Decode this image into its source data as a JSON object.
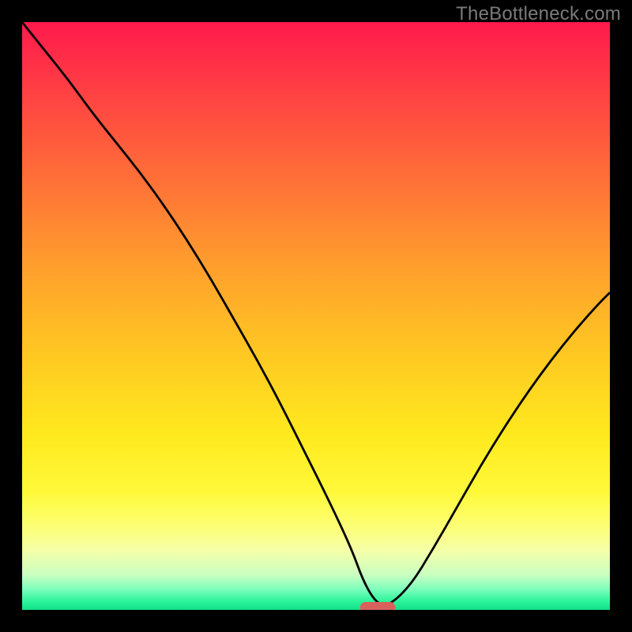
{
  "watermark": "TheBottleneck.com",
  "colors": {
    "frame": "#000000",
    "watermark": "#7a7a7a",
    "curve": "#000000",
    "marker_fill": "#d9615d",
    "gradient_stops": [
      {
        "offset": 0.0,
        "color": "#ff1a4c"
      },
      {
        "offset": 0.1,
        "color": "#ff3a45"
      },
      {
        "offset": 0.25,
        "color": "#ff6a39"
      },
      {
        "offset": 0.4,
        "color": "#ff9a2e"
      },
      {
        "offset": 0.55,
        "color": "#ffc423"
      },
      {
        "offset": 0.7,
        "color": "#ffe91e"
      },
      {
        "offset": 0.8,
        "color": "#fff93a"
      },
      {
        "offset": 0.86,
        "color": "#fcff77"
      },
      {
        "offset": 0.9,
        "color": "#f4ffa9"
      },
      {
        "offset": 0.94,
        "color": "#caffc1"
      },
      {
        "offset": 0.965,
        "color": "#7dffbc"
      },
      {
        "offset": 0.985,
        "color": "#2cf49b"
      },
      {
        "offset": 1.0,
        "color": "#10df87"
      }
    ]
  },
  "chart_data": {
    "type": "line",
    "title": "",
    "xlabel": "",
    "ylabel": "",
    "xlim": [
      0,
      100
    ],
    "ylim": [
      0,
      100
    ],
    "x": [
      0,
      4,
      8,
      12,
      16,
      20,
      24,
      28,
      32,
      36,
      40,
      44,
      48,
      52,
      56,
      58,
      60,
      62,
      66,
      70,
      74,
      78,
      82,
      86,
      90,
      94,
      98,
      100
    ],
    "values": [
      100,
      95,
      90,
      84.5,
      79.5,
      74.5,
      69,
      63,
      56.5,
      49.5,
      42.5,
      35,
      27,
      19,
      10.5,
      5,
      1.5,
      0.4,
      4,
      10.5,
      17.5,
      24.5,
      31,
      37,
      42.5,
      47.5,
      52,
      54
    ],
    "marker": {
      "x_center": 60.5,
      "width": 6,
      "y": 0.4
    }
  }
}
